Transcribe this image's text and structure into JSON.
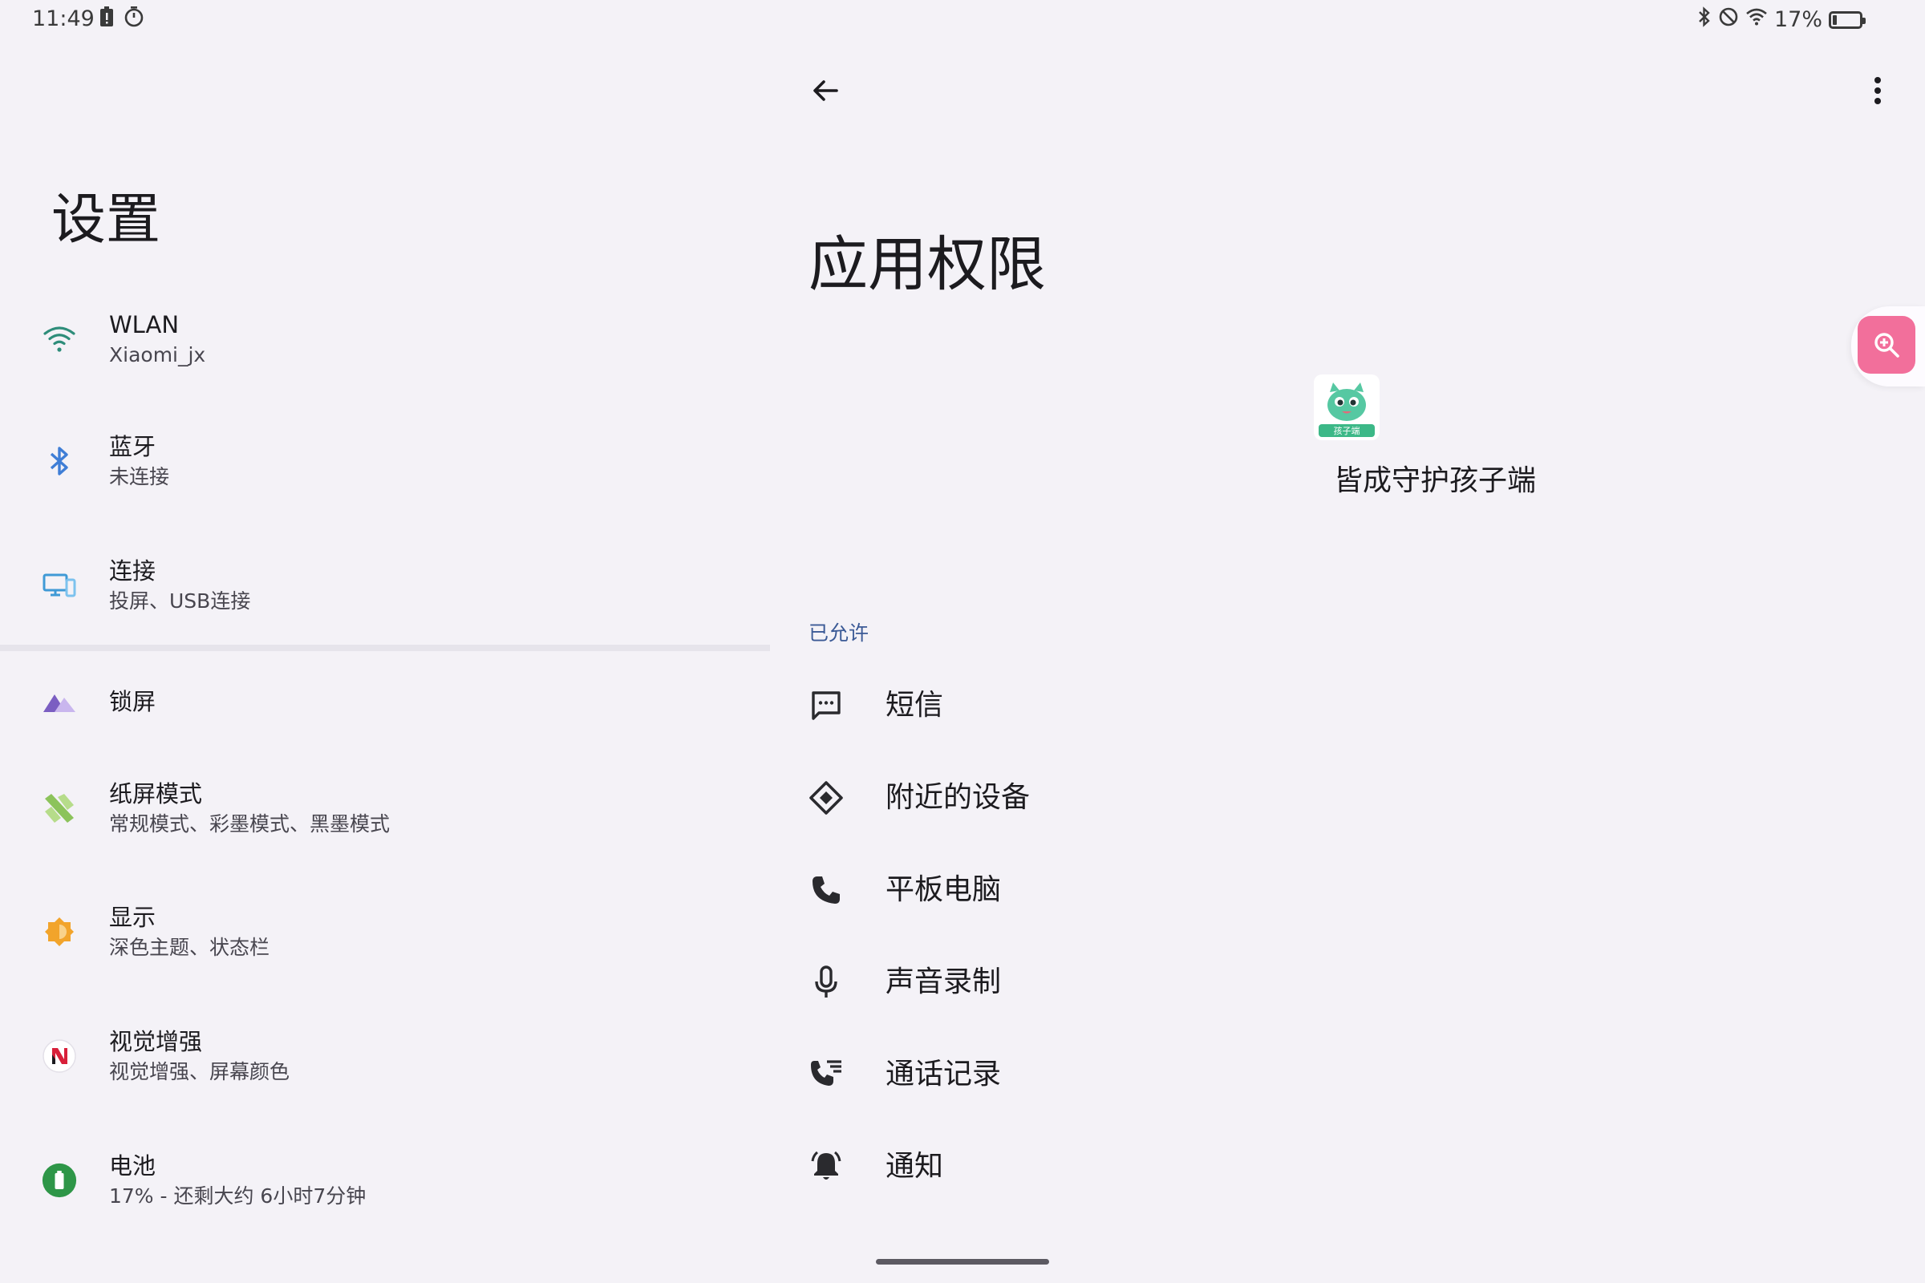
{
  "status_bar": {
    "time": "11:49",
    "battery_percent": "17%",
    "battery_level": 0.17,
    "icons_left": [
      "battery-alert-icon",
      "timer-icon"
    ],
    "icons_right": [
      "bluetooth-icon",
      "do-not-disturb-icon",
      "wifi-icon",
      "battery-icon"
    ]
  },
  "left": {
    "title": "设置",
    "items": [
      {
        "icon": "wifi-icon",
        "title": "WLAN",
        "subtitle": "Xiaomi_jx",
        "color": "#2e8d7a"
      },
      {
        "icon": "bluetooth-icon",
        "title": "蓝牙",
        "subtitle": "未连接",
        "color": "#3f7ed6"
      },
      {
        "icon": "connected-devices-icon",
        "title": "连接",
        "subtitle": "投屏、USB连接",
        "color": "#3f9ad6"
      },
      {
        "icon": "lock-screen-icon",
        "title": "锁屏",
        "subtitle": "",
        "color": "#7b5ec2"
      },
      {
        "icon": "paper-mode-icon",
        "title": "纸屏模式",
        "subtitle": "常规模式、彩墨模式、黑墨模式",
        "color": "#8cc35b"
      },
      {
        "icon": "display-icon",
        "title": "显示",
        "subtitle": "深色主题、状态栏",
        "color": "#f2a42b"
      },
      {
        "icon": "visual-enhance-icon",
        "title": "视觉增强",
        "subtitle": "视觉增强、屏幕颜色",
        "color": "#d8203a"
      },
      {
        "icon": "battery-icon",
        "title": "电池",
        "subtitle": "17% - 还剩大约 6小时7分钟",
        "color": "#2e9648"
      }
    ]
  },
  "right": {
    "title": "应用权限",
    "app_name": "皆成守护孩子端",
    "app_icon_label": "孩子端",
    "section_header": "已允许",
    "permissions": [
      {
        "icon": "sms-icon",
        "label": "短信"
      },
      {
        "icon": "nearby-devices-icon",
        "label": "附近的设备"
      },
      {
        "icon": "phone-icon",
        "label": "平板电脑"
      },
      {
        "icon": "microphone-icon",
        "label": "声音录制"
      },
      {
        "icon": "call-log-icon",
        "label": "通话记录"
      },
      {
        "icon": "notification-icon",
        "label": "通知"
      }
    ]
  },
  "floating": {
    "icon": "zoom-in-icon",
    "color": "#f26f9b"
  }
}
